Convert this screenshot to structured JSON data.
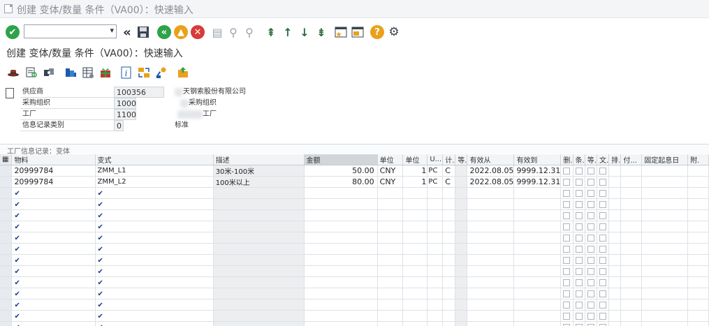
{
  "window": {
    "title": "创建 变体/数量 条件（VA00）：快速输入"
  },
  "screen": {
    "title": "创建 变体/数量 条件（VA00）：快速输入"
  },
  "toolbar": {
    "command_value": "",
    "icons": [
      "enter-icon",
      "back-icon",
      "save-icon",
      "back-green-icon",
      "exit-icon",
      "cancel-icon",
      "print-icon",
      "find-icon",
      "find-next-icon",
      "first-page-icon",
      "prev-page-icon",
      "next-page-icon",
      "last-page-icon",
      "new-session-icon",
      "shortcut-icon",
      "help-icon",
      "settings-icon"
    ]
  },
  "header": {
    "fields": [
      {
        "label": "供应商",
        "value": "100356",
        "desc": "天钢索股份有限公司"
      },
      {
        "label": "采购组织",
        "value": "1000",
        "desc": "采购组织"
      },
      {
        "label": "工厂",
        "value": "1100",
        "desc": "工厂"
      },
      {
        "label": "信息记录类别",
        "value": "0",
        "desc": "标准"
      }
    ]
  },
  "section": {
    "title": "工厂信息记录：变体"
  },
  "table": {
    "columns": [
      "物料",
      "变式",
      "描述",
      "金额",
      "单位",
      "单位",
      "U...",
      "计.",
      "等.",
      "有效从",
      "有效到",
      "删.",
      "条.",
      "等.",
      "文.",
      "排.",
      "付...",
      "固定起息日",
      "附."
    ],
    "rows": [
      {
        "material": "20999784",
        "variant": "ZMM_L1",
        "desc": "30米-100米",
        "amount": "50.00",
        "currency": "CNY",
        "per": "1",
        "uom": "PC",
        "calc": "C",
        "valid_from": "2022.08.05",
        "valid_to": "9999.12.31"
      },
      {
        "material": "20999784",
        "variant": "ZMM_L2",
        "desc": "100米以上",
        "amount": "80.00",
        "currency": "CNY",
        "per": "1",
        "uom": "PC",
        "calc": "C",
        "valid_from": "2022.08.05",
        "valid_to": "9999.12.31"
      }
    ],
    "empty_row_marker": "✔"
  },
  "colors": {
    "accent_green": "#2fa24a",
    "accent_orange": "#e9a11b",
    "accent_red": "#d93a3a"
  }
}
